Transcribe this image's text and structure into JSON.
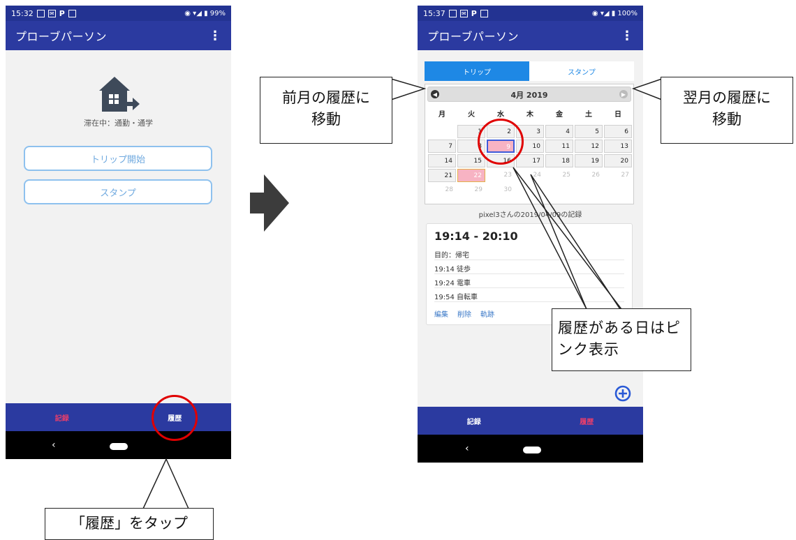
{
  "phone1": {
    "status": {
      "time": "15:32",
      "right": "99%"
    },
    "app_title": "プローブパーソン",
    "state_text": "滞在中：通勤・通学",
    "buttons": {
      "trip_start": "トリップ開始",
      "stamp": "スタンプ"
    },
    "nav": {
      "record": "記録",
      "history": "履歴"
    },
    "back": "‹"
  },
  "phone2": {
    "status": {
      "time": "15:37",
      "right": "100%"
    },
    "app_title": "プローブパーソン",
    "tabs": {
      "trip": "トリップ",
      "stamp": "スタンプ"
    },
    "calendar": {
      "month": "4月 2019",
      "weekdays": [
        "月",
        "火",
        "水",
        "木",
        "金",
        "土",
        "日"
      ],
      "weeks": [
        [
          "",
          "1",
          "2",
          "3",
          "4",
          "5",
          "6"
        ],
        [
          "7",
          "8",
          "9",
          "10",
          "11",
          "12",
          "13"
        ],
        [
          "14",
          "15",
          "16",
          "17",
          "18",
          "19",
          "20"
        ],
        [
          "21",
          "22",
          "23",
          "24",
          "25",
          "26",
          "27"
        ],
        [
          "28",
          "29",
          "30",
          "",
          "",
          "",
          ""
        ]
      ]
    },
    "record_caption": "pixel3さんの2019/04/09の記録",
    "record": {
      "time_range": "19:14 - 20:10",
      "purpose": "目的：帰宅",
      "legs": [
        "19:14 徒歩",
        "19:24 電車",
        "19:54 自転車"
      ],
      "actions": {
        "edit": "編集",
        "delete": "削除",
        "track": "軌跡"
      }
    },
    "nav": {
      "record": "記録",
      "history": "履歴"
    },
    "back": "‹"
  },
  "callouts": {
    "prev": "前月の履歴に移動",
    "next": "翌月の履歴に移動",
    "pink": "履歴がある日はピンク表示",
    "tap": "「履歴」をタップ"
  },
  "colors": {
    "appbar": "#2b3aa0",
    "accent_pink": "#e83e6b",
    "tab_active": "#1e88e5",
    "highlight_pink": "#f7b3c3",
    "circle_red": "#e00000"
  }
}
